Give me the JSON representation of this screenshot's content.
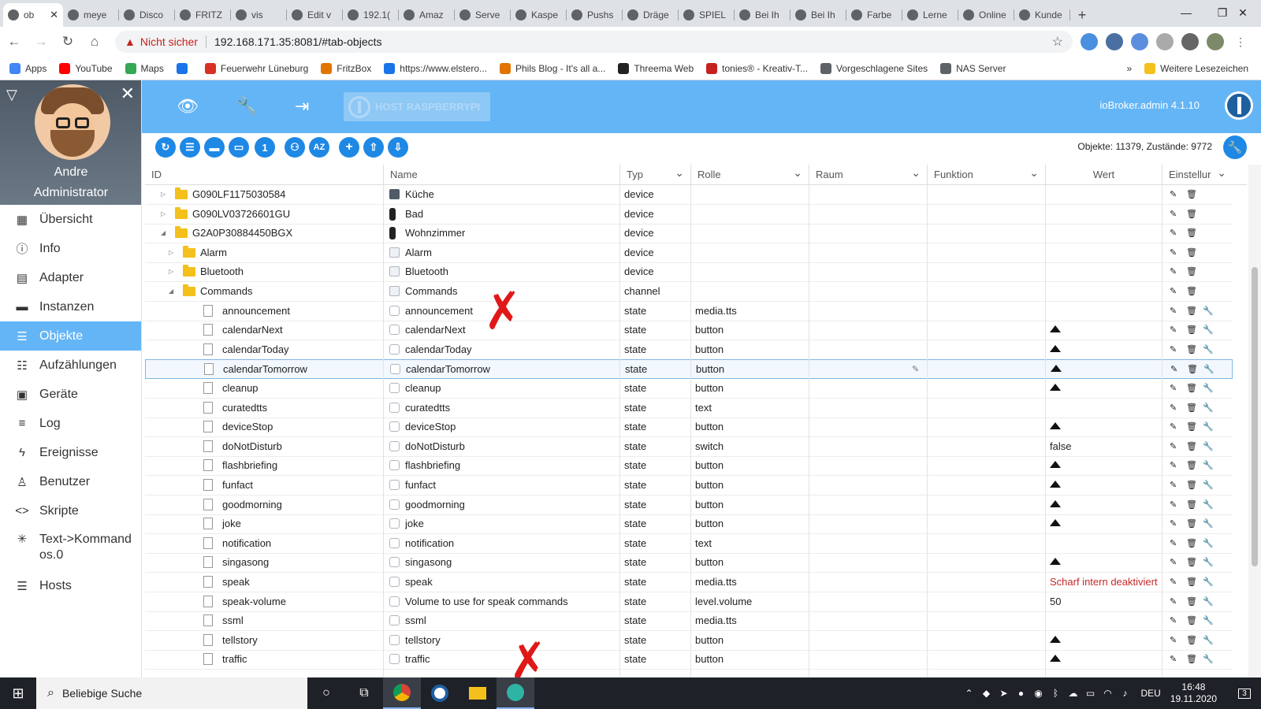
{
  "browser": {
    "tabs": [
      {
        "label": "ob",
        "active": true,
        "icon": "iobroker-icon"
      },
      {
        "label": "meye",
        "icon": "chrome-tab-icon"
      },
      {
        "label": "Disco",
        "icon": "d-icon"
      },
      {
        "label": "FRITZ",
        "icon": "fritz-icon"
      },
      {
        "label": "vis",
        "icon": "vis-icon"
      },
      {
        "label": "Edit v",
        "icon": "edit-icon"
      },
      {
        "label": "192.1(",
        "icon": "globe-icon"
      },
      {
        "label": "Amaz",
        "icon": "pin-icon"
      },
      {
        "label": "Serve",
        "icon": "server-icon"
      },
      {
        "label": "Kaspe",
        "icon": "globe-icon"
      },
      {
        "label": "Pushs",
        "icon": "push-icon"
      },
      {
        "label": "Dräge",
        "icon": "draeger-icon"
      },
      {
        "label": "SPIEL",
        "icon": "spiel-icon"
      },
      {
        "label": "Bei Ih",
        "icon": "ms-icon"
      },
      {
        "label": "Bei Ih",
        "icon": "ms-icon"
      },
      {
        "label": "Farbe",
        "icon": "globe-icon"
      },
      {
        "label": "Lerne",
        "icon": "lp-icon"
      },
      {
        "label": "Online",
        "icon": "globe-icon"
      },
      {
        "label": "Kunde",
        "icon": "dark-icon"
      }
    ],
    "security_label": "Nicht sicher",
    "url": "192.168.171.35:8081/#tab-objects",
    "bookmarks": [
      "Apps",
      "YouTube",
      "Maps",
      "",
      "Feuerwehr Lüneburg",
      "FritzBox",
      "https://www.elstero...",
      "Phils Blog - It's all a...",
      "Threema Web",
      "tonies® - Kreativ-T...",
      "Vorgeschlagene Sites",
      "NAS Server"
    ],
    "more_bookmarks": "»",
    "other_bookmarks": "Weitere Lesezeichen"
  },
  "sidebar": {
    "user_name": "Andre",
    "user_role": "Administrator",
    "items": [
      {
        "label": "Übersicht",
        "icon": "grid-icon"
      },
      {
        "label": "Info",
        "icon": "info-icon"
      },
      {
        "label": "Adapter",
        "icon": "store-icon"
      },
      {
        "label": "Instanzen",
        "icon": "instances-icon"
      },
      {
        "label": "Objekte",
        "icon": "list-icon",
        "active": true
      },
      {
        "label": "Aufzählungen",
        "icon": "enum-icon"
      },
      {
        "label": "Geräte",
        "icon": "devices-icon"
      },
      {
        "label": "Log",
        "icon": "log-icon"
      },
      {
        "label": "Ereignisse",
        "icon": "bolt-icon"
      },
      {
        "label": "Benutzer",
        "icon": "user-icon"
      },
      {
        "label": "Skripte",
        "icon": "code-icon"
      },
      {
        "label": "Text->Kommandos.0",
        "icon": "asterisk-icon"
      },
      {
        "label": "Hosts",
        "icon": "hosts-icon"
      }
    ]
  },
  "header": {
    "host_label": "HOST RASPBERRYPI",
    "admin_version": "ioBroker.admin 4.1.10"
  },
  "toolbar": {
    "buttons": [
      "refresh-button",
      "list-view-button",
      "folder-open-button",
      "folder-closed-button",
      "counter-button",
      "users-filter-button",
      "sort-az-button",
      "add-object-button",
      "upload-button",
      "download-button"
    ],
    "counter_label": "1",
    "sort_label": "AZ",
    "object_count": "Objekte: 11379, Zustände: 9772"
  },
  "table": {
    "columns": [
      "ID",
      "Name",
      "Typ",
      "Rolle",
      "Raum",
      "Funktion",
      "Wert",
      "Einstellur"
    ],
    "rows": [
      {
        "id": "G090LF1175030584",
        "name": "Küche",
        "type": "device",
        "role": "",
        "value": "",
        "level": 0,
        "node": "folder",
        "expand": "collapsed",
        "nicon": "dev"
      },
      {
        "id": "G090LV03726601GU",
        "name": "Bad",
        "type": "device",
        "role": "",
        "value": "",
        "level": 0,
        "node": "folder",
        "expand": "collapsed",
        "nicon": "dark"
      },
      {
        "id": "G2A0P30884450BGX",
        "name": "Wohnzimmer",
        "type": "device",
        "role": "",
        "value": "",
        "level": 0,
        "node": "folder",
        "expand": "expanded",
        "nicon": "dark"
      },
      {
        "id": "Alarm",
        "name": "Alarm",
        "type": "device",
        "role": "",
        "value": "",
        "level": 1,
        "node": "folder",
        "expand": "collapsed",
        "nicon": "box"
      },
      {
        "id": "Bluetooth",
        "name": "Bluetooth",
        "type": "device",
        "role": "",
        "value": "",
        "level": 1,
        "node": "folder",
        "expand": "collapsed",
        "nicon": "box"
      },
      {
        "id": "Commands",
        "name": "Commands",
        "type": "channel",
        "role": "",
        "value": "",
        "level": 1,
        "node": "folder",
        "expand": "expanded",
        "nicon": "box"
      },
      {
        "id": "announcement",
        "name": "announcement",
        "type": "state",
        "role": "media.tts",
        "value": "",
        "level": 2,
        "node": "file",
        "nicon": "st"
      },
      {
        "id": "calendarNext",
        "name": "calendarNext",
        "type": "state",
        "role": "button",
        "value": "▲",
        "level": 2,
        "node": "file",
        "nicon": "st"
      },
      {
        "id": "calendarToday",
        "name": "calendarToday",
        "type": "state",
        "role": "button",
        "value": "▲",
        "level": 2,
        "node": "file",
        "nicon": "st"
      },
      {
        "id": "calendarTomorrow",
        "name": "calendarTomorrow",
        "type": "state",
        "role": "button",
        "value": "▲",
        "level": 2,
        "node": "file",
        "nicon": "st",
        "selected": true
      },
      {
        "id": "cleanup",
        "name": "cleanup",
        "type": "state",
        "role": "button",
        "value": "▲",
        "level": 2,
        "node": "file",
        "nicon": "st"
      },
      {
        "id": "curatedtts",
        "name": "curatedtts",
        "type": "state",
        "role": "text",
        "value": "",
        "level": 2,
        "node": "file",
        "nicon": "st"
      },
      {
        "id": "deviceStop",
        "name": "deviceStop",
        "type": "state",
        "role": "button",
        "value": "▲",
        "level": 2,
        "node": "file",
        "nicon": "st"
      },
      {
        "id": "doNotDisturb",
        "name": "doNotDisturb",
        "type": "state",
        "role": "switch",
        "value": "false",
        "level": 2,
        "node": "file",
        "nicon": "st"
      },
      {
        "id": "flashbriefing",
        "name": "flashbriefing",
        "type": "state",
        "role": "button",
        "value": "▲",
        "level": 2,
        "node": "file",
        "nicon": "st"
      },
      {
        "id": "funfact",
        "name": "funfact",
        "type": "state",
        "role": "button",
        "value": "▲",
        "level": 2,
        "node": "file",
        "nicon": "st"
      },
      {
        "id": "goodmorning",
        "name": "goodmorning",
        "type": "state",
        "role": "button",
        "value": "▲",
        "level": 2,
        "node": "file",
        "nicon": "st"
      },
      {
        "id": "joke",
        "name": "joke",
        "type": "state",
        "role": "button",
        "value": "▲",
        "level": 2,
        "node": "file",
        "nicon": "st"
      },
      {
        "id": "notification",
        "name": "notification",
        "type": "state",
        "role": "text",
        "value": "",
        "level": 2,
        "node": "file",
        "nicon": "st"
      },
      {
        "id": "singasong",
        "name": "singasong",
        "type": "state",
        "role": "button",
        "value": "▲",
        "level": 2,
        "node": "file",
        "nicon": "st"
      },
      {
        "id": "speak",
        "name": "speak",
        "type": "state",
        "role": "media.tts",
        "value": "Scharf intern deaktiviert",
        "value_color": "#c62828",
        "level": 2,
        "node": "file",
        "nicon": "st"
      },
      {
        "id": "speak-volume",
        "name": "Volume to use for speak commands",
        "type": "state",
        "role": "level.volume",
        "value": "50",
        "level": 2,
        "node": "file",
        "nicon": "st"
      },
      {
        "id": "ssml",
        "name": "ssml",
        "type": "state",
        "role": "media.tts",
        "value": "",
        "level": 2,
        "node": "file",
        "nicon": "st"
      },
      {
        "id": "tellstory",
        "name": "tellstory",
        "type": "state",
        "role": "button",
        "value": "▲",
        "level": 2,
        "node": "file",
        "nicon": "st"
      },
      {
        "id": "traffic",
        "name": "traffic",
        "type": "state",
        "role": "button",
        "value": "▲",
        "level": 2,
        "node": "file",
        "nicon": "st"
      }
    ],
    "annotations": [
      "✗",
      "✗"
    ]
  },
  "taskbar": {
    "search_placeholder": "Beliebige Suche",
    "language": "DEU",
    "time": "16:48",
    "date": "19.11.2020",
    "notification_count": "3"
  }
}
